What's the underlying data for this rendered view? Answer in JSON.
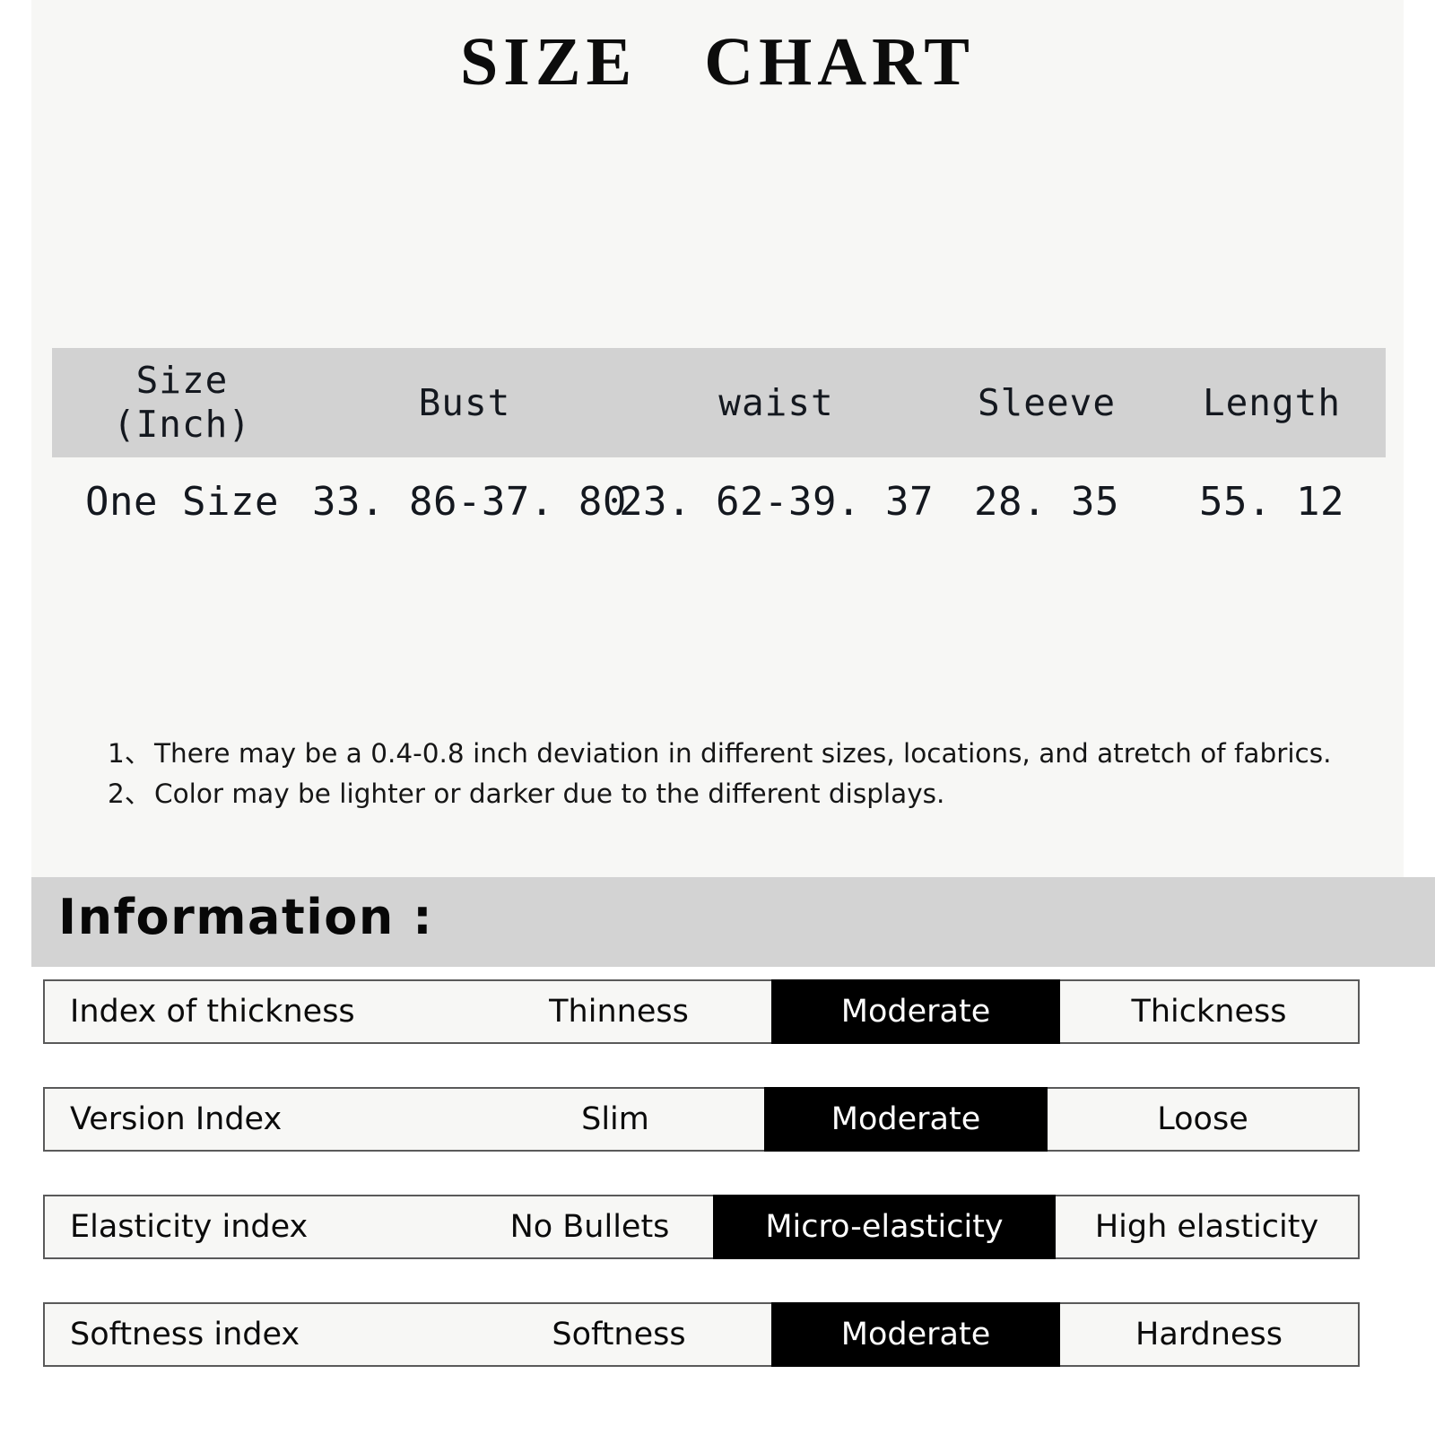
{
  "title": "SIZE   CHART",
  "size_table": {
    "headers": [
      "Size\n(Inch)",
      "Bust",
      "waist",
      "Sleeve",
      "Length"
    ],
    "header_size_line1": "Size",
    "header_size_line2": "(Inch)",
    "rows": [
      {
        "size": "One Size",
        "bust": "33. 86-37. 80",
        "waist": "23. 62-39. 37",
        "sleeve": "28. 35",
        "length": "55. 12"
      }
    ],
    "header_bg": "#d2d2d2"
  },
  "notes": [
    {
      "number": "1、",
      "text": "There may be a 0.4-0.8 inch deviation in different sizes, locations, and atretch of fabrics."
    },
    {
      "number": "2、",
      "text": "Color may be lighter or darker due to the different displays."
    }
  ],
  "information": {
    "band_title": "Information :",
    "band_bg": "#d3d3d3",
    "highlight_bg": "#000000",
    "highlight_fg": "#ffffff",
    "rows": [
      {
        "label": "Index of thickness",
        "options": [
          "Thinness",
          "Moderate",
          "Thickness"
        ],
        "selected": "Moderate",
        "selected_index": 1
      },
      {
        "label": "Version Index",
        "options": [
          "Slim",
          "Moderate",
          "Loose"
        ],
        "selected": "Moderate",
        "selected_index": 1
      },
      {
        "label": "Elasticity index",
        "options": [
          "No Bullets",
          "Micro-elasticity",
          "High elasticity"
        ],
        "selected": "Micro-elasticity",
        "selected_index": 1
      },
      {
        "label": "Softness index",
        "options": [
          "Softness",
          "Moderate",
          "Hardness"
        ],
        "selected": "Moderate",
        "selected_index": 1
      }
    ]
  }
}
